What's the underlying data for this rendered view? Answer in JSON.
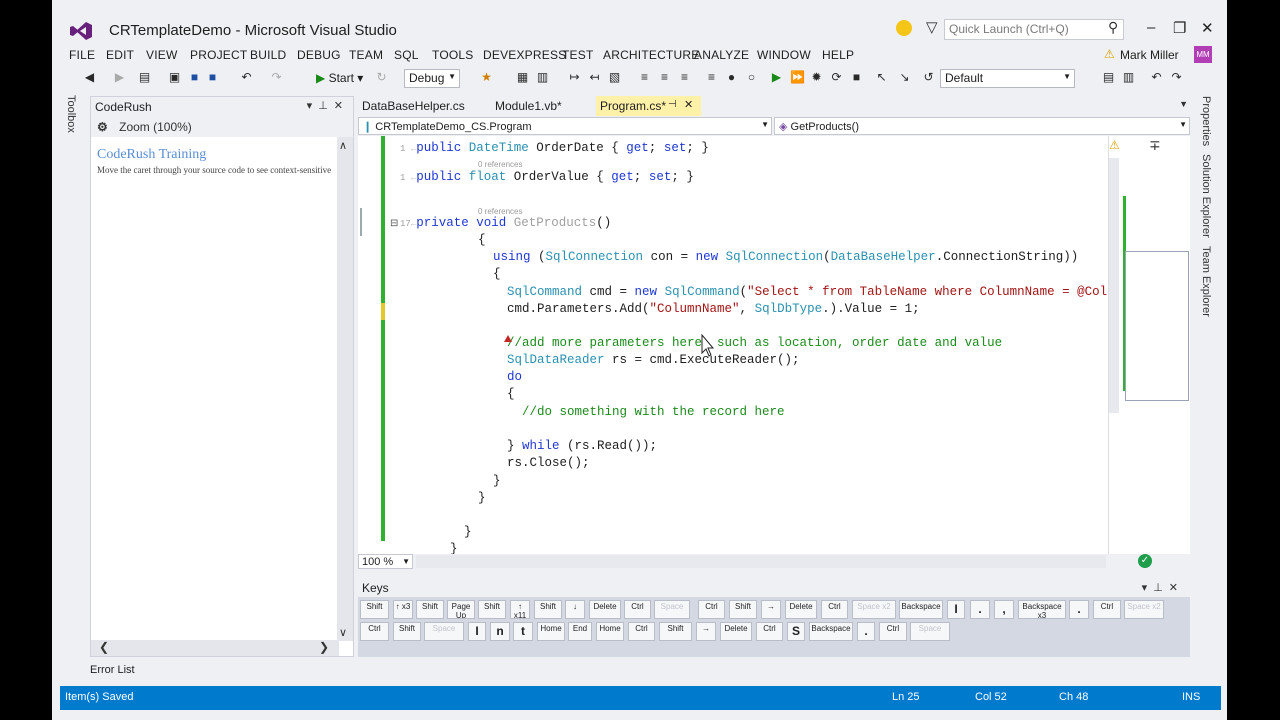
{
  "window": {
    "title": "CRTemplateDemo - Microsoft Visual Studio",
    "quick_launch_placeholder": "Quick Launch (Ctrl+Q)"
  },
  "menu": {
    "items": [
      "FILE",
      "EDIT",
      "VIEW",
      "PROJECT",
      "BUILD",
      "DEBUG",
      "TEAM",
      "SQL",
      "TOOLS",
      "DEVEXPRESS",
      "TEST",
      "ARCHITECTURE",
      "ANALYZE",
      "WINDOW",
      "HELP"
    ],
    "user": "Mark Miller",
    "user_initials": "MM"
  },
  "toolbar": {
    "start_label": "Start",
    "config": "Debug",
    "layout": "Default"
  },
  "left_strip": {
    "toolbox": "Toolbox"
  },
  "coderush": {
    "panel_title": "CodeRush",
    "zoom_label": "Zoom (100%)",
    "training_title": "CodeRush Training",
    "training_desc": "Move the caret through your source code to see context-sensitive"
  },
  "tabs": [
    {
      "label": "DataBaseHelper.cs"
    },
    {
      "label": "Module1.vb*"
    },
    {
      "label": "Program.cs*"
    }
  ],
  "navbar": {
    "class_path": "CRTemplateDemo_CS.Program",
    "member": "GetProducts()"
  },
  "editor": {
    "references_0": "0 references",
    "lens_1": "1",
    "lens_17": "17",
    "code": {
      "l1_a": "public ",
      "l1_b": "DateTime",
      "l1_c": " OrderDate { ",
      "l1_d": "get",
      "l1_e": "; ",
      "l1_f": "set",
      "l1_g": "; }",
      "l2_a": "public ",
      "l2_b": "float",
      "l2_c": " OrderValue { ",
      "l2_d": "get",
      "l2_e": "; ",
      "l2_f": "set",
      "l2_g": "; }",
      "l3_a": "private ",
      "l3_b": "void",
      "l3_c": " GetProducts",
      "l3_d": "()",
      "l4": "{",
      "l5_a": "using",
      "l5_b": " (",
      "l5_c": "SqlConnection",
      "l5_d": " con = ",
      "l5_e": "new",
      "l5_f": " ",
      "l5_g": "SqlConnection",
      "l5_h": "(",
      "l5_i": "DataBaseHelper",
      "l5_j": ".ConnectionString))",
      "l6": "{",
      "l7_a": "SqlCommand",
      "l7_b": " cmd = ",
      "l7_c": "new",
      "l7_d": " ",
      "l7_e": "SqlCommand",
      "l7_f": "(",
      "l7_g": "\"Select * from TableName where ColumnName = @ColumnName\"",
      "l7_h": ",",
      "l8_a": "cmd.Parameters.Add(",
      "l8_b": "\"ColumnName\"",
      "l8_c": ", ",
      "l8_d": "SqlDbType",
      "l8_e": ".).Value = 1;",
      "l9": "//add more parameters here  such as location, order date and value",
      "l10_a": "SqlDataReader",
      "l10_b": " rs = cmd.ExecuteReader();",
      "l11": "do",
      "l12": "{",
      "l13": "//do something with the record here",
      "l14_a": "} ",
      "l14_b": "while",
      "l14_c": " (rs.Read());",
      "l15": "rs.Close();",
      "l16": "}",
      "l17": "}",
      "l18": "}",
      "l19": "}"
    }
  },
  "zoom": {
    "level": "100 %"
  },
  "right_strip": {
    "properties": "Properties",
    "solution_explorer": "Solution Explorer",
    "team_explorer": "Team Explorer"
  },
  "keys_panel": {
    "title": "Keys",
    "row1": [
      "Esc",
      "Shift",
      "Shift",
      "Page Up",
      "Shift",
      "↑ x11",
      "Shift",
      "↓",
      "Delete",
      "Ctrl",
      "Space",
      "Ctrl",
      "Shift",
      "→",
      "Delete",
      "Ctrl",
      "Space x2",
      "Backspace",
      "I",
      ".",
      ",",
      "Backspace x3",
      ".",
      "Ctrl",
      "Space x2"
    ],
    "row1_first": "↑ x3",
    "row2": [
      "Ctrl",
      "Shift",
      "Space",
      "I",
      "n",
      "t",
      "Home",
      "End",
      "Home",
      "Ctrl",
      "Shift",
      "→",
      "Delete",
      "Ctrl",
      "S",
      "Backspace",
      ".",
      "Ctrl",
      "Space"
    ]
  },
  "bottom": {
    "error_list": "Error List"
  },
  "status": {
    "message": "Item(s) Saved",
    "ln": "Ln 25",
    "col": "Col 52",
    "ch": "Ch 48",
    "mode": "INS"
  },
  "colors": {
    "accent": "#007acc",
    "active_tab": "#fff1a8",
    "keyword": "#1f37d2",
    "type": "#2b91af",
    "string": "#a31515",
    "comment": "#1d8a1d"
  }
}
